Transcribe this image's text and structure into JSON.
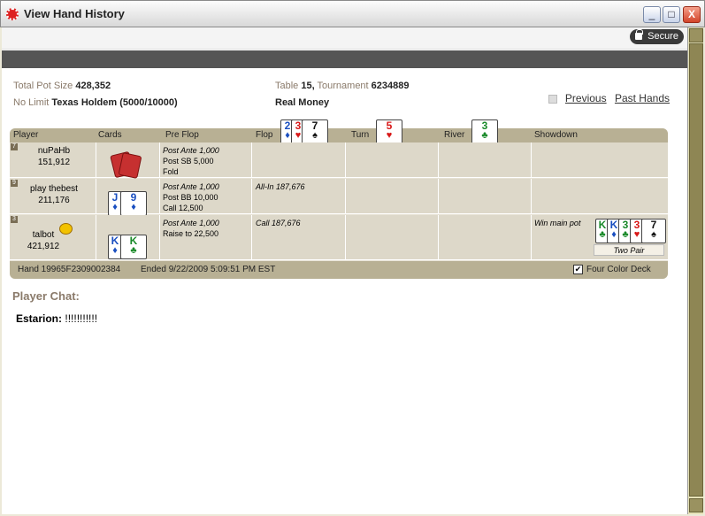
{
  "window": {
    "title": "View Hand History",
    "min": "_",
    "max": "□",
    "close": "X"
  },
  "secure": "Secure",
  "info": {
    "pot_label": "Total Pot Size",
    "pot_value": "428,352",
    "table_label": "Table",
    "table_value": "15,",
    "tourn_label": "Tournament",
    "tourn_value": "6234889",
    "limit_label": "No Limit",
    "game_value": "Texas Holdem",
    "blinds": "(5000/10000)",
    "money": "Real Money"
  },
  "links": {
    "previous": "Previous",
    "past": "Past Hands"
  },
  "headers": {
    "player": "Player",
    "cards": "Cards",
    "preflop": "Pre Flop",
    "flop": "Flop",
    "turn": "Turn",
    "river": "River",
    "showdown": "Showdown"
  },
  "board": {
    "flop": [
      {
        "r": "2",
        "s": "♦",
        "c": "blue"
      },
      {
        "r": "3",
        "s": "♥",
        "c": "red"
      },
      {
        "r": "7",
        "s": "♠",
        "c": "blk"
      }
    ],
    "turn": {
      "r": "5",
      "s": "♥",
      "c": "red"
    },
    "river": {
      "r": "3",
      "s": "♣",
      "c": "green"
    }
  },
  "players": [
    {
      "seat": "7",
      "name": "nuPaHb",
      "stack": "151,912",
      "preflop": [
        "Post Ante 1,000",
        "Post SB 5,000",
        "Fold"
      ],
      "flop": "",
      "showdown": ""
    },
    {
      "seat": "9",
      "name": "play thebest",
      "stack": "211,176",
      "preflop": [
        "Post Ante 1,000",
        "Post BB 10,000",
        "Call 12,500"
      ],
      "flop": "All-In 187,676",
      "showdown": "",
      "cards": [
        {
          "r": "J",
          "s": "♦",
          "c": "blue"
        },
        {
          "r": "9",
          "s": "♦",
          "c": "blue"
        }
      ]
    },
    {
      "seat": "3",
      "name": "talbot",
      "stack": "421,912",
      "preflop": [
        "Post Ante 1,000",
        "Raise to 22,500"
      ],
      "flop": "Call 187,676",
      "showdown": "Win main pot",
      "cards": [
        {
          "r": "K",
          "s": "♦",
          "c": "blue"
        },
        {
          "r": "K",
          "s": "♣",
          "c": "green"
        }
      ],
      "hand": "Two Pair",
      "best": [
        {
          "r": "K",
          "s": "♣",
          "c": "green"
        },
        {
          "r": "K",
          "s": "♦",
          "c": "blue"
        },
        {
          "r": "3",
          "s": "♣",
          "c": "green"
        },
        {
          "r": "3",
          "s": "♥",
          "c": "red"
        },
        {
          "r": "7",
          "s": "♠",
          "c": "blk"
        }
      ]
    }
  ],
  "footer": {
    "hand": "Hand 19965F2309002384",
    "ended": "Ended 9/22/2009 5:09:51 PM EST",
    "fourcolor": "Four Color Deck",
    "check": "✔"
  },
  "chat": {
    "title": "Player Chat:",
    "user": "Estarion:",
    "message": "!!!!!!!!!!!"
  }
}
